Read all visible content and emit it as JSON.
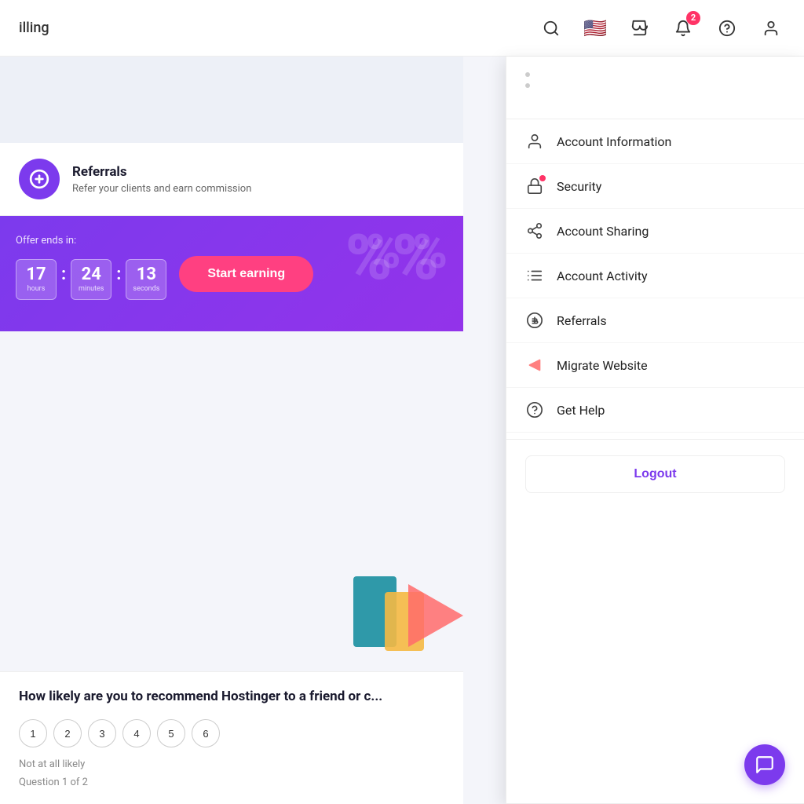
{
  "nav": {
    "title": "illing",
    "badge_count": "2"
  },
  "referrals": {
    "title": "Referrals",
    "subtitle": "Refer your clients and earn commission"
  },
  "promo": {
    "offer_label": "Offer ends in:",
    "hours": "17",
    "minutes": "24",
    "seconds": "13",
    "hours_label": "hours",
    "minutes_label": "minutes",
    "seconds_label": "seconds",
    "cta_label": "Start earning"
  },
  "survey": {
    "question": "How likely are you to recommend Hostinger to a friend or c...",
    "not_likely_label": "Not at all likely",
    "progress": "Question 1 of 2",
    "ratings": [
      "1",
      "2",
      "3",
      "4",
      "5",
      "6"
    ]
  },
  "dropdown": {
    "items": [
      {
        "id": "account-info",
        "label": "Account Information",
        "icon": "person"
      },
      {
        "id": "security",
        "label": "Security",
        "icon": "lock",
        "has_dot": true
      },
      {
        "id": "account-sharing",
        "label": "Account Sharing",
        "icon": "share"
      },
      {
        "id": "account-activity",
        "label": "Account Activity",
        "icon": "list"
      },
      {
        "id": "referrals",
        "label": "Referrals",
        "icon": "dollar"
      },
      {
        "id": "migrate-website",
        "label": "Migrate Website",
        "icon": "arrow-right"
      },
      {
        "id": "get-help",
        "label": "Get Help",
        "icon": "question"
      }
    ],
    "logout_label": "Logout"
  }
}
